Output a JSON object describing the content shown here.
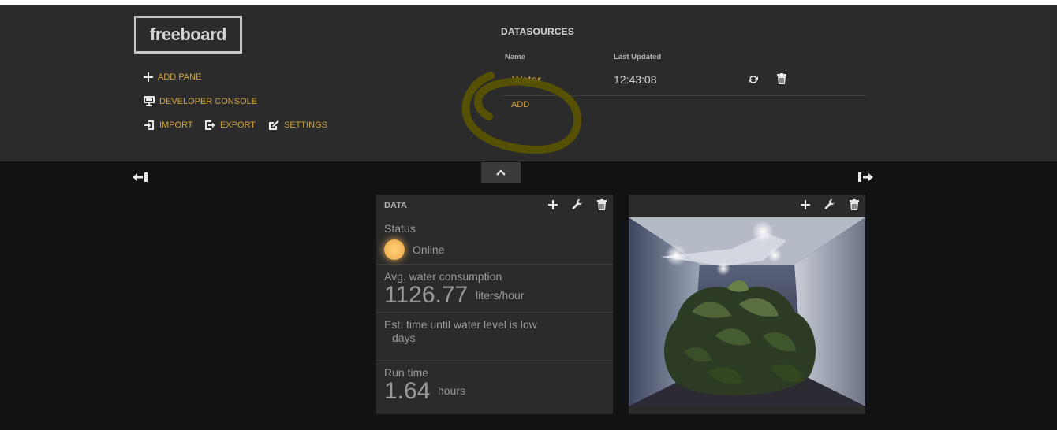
{
  "app": {
    "logo": "freeboard"
  },
  "menu": {
    "add_pane": "ADD PANE",
    "developer_console": "DEVELOPER CONSOLE",
    "import": "IMPORT",
    "export": "EXPORT",
    "settings": "SETTINGS"
  },
  "datasources": {
    "title": "DATASOURCES",
    "columns": {
      "name": "Name",
      "last_updated": "Last Updated"
    },
    "rows": [
      {
        "name": "Water",
        "last_updated": "12:43:08"
      }
    ],
    "add_label": "ADD"
  },
  "panes": [
    {
      "title": "DATA",
      "widgets": [
        {
          "title": "Status",
          "indicator_text": "Online",
          "indicator_color": "#f5b85a"
        },
        {
          "title": "Avg. water consumption",
          "value": "1126.77",
          "units": "liters/hour"
        },
        {
          "title": "Est. time until water level is low",
          "value": "",
          "units": "days"
        },
        {
          "title": "Run time",
          "value": "1.64",
          "units": "hours"
        }
      ]
    },
    {
      "title": "",
      "image": "grow-chamber-camera-photo"
    }
  ],
  "colors": {
    "accent": "#d1a23e",
    "header_bg": "#2b2b2b",
    "page_bg": "#101214",
    "pane_bg": "#2b2b2b"
  }
}
